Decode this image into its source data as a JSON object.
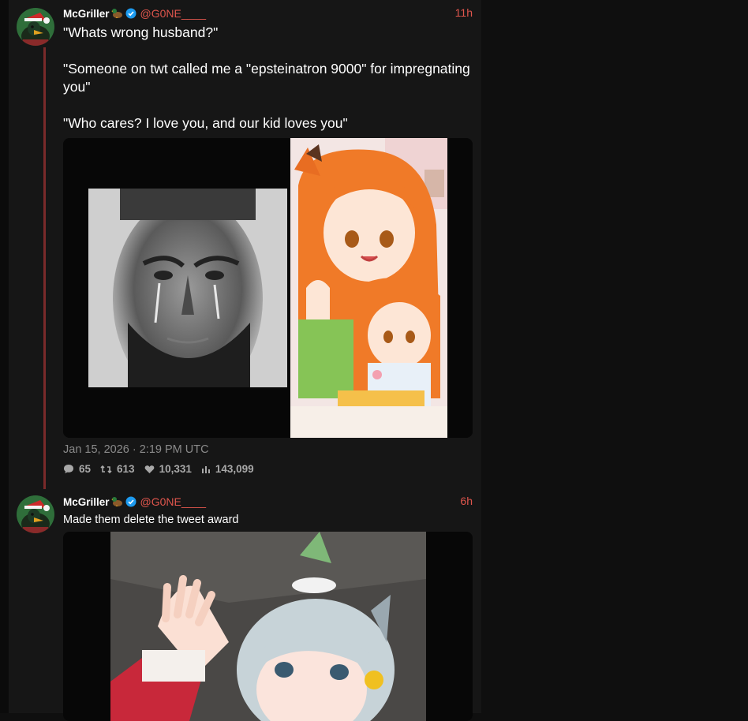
{
  "tweets": [
    {
      "author_name": "McGriller",
      "handle": "@G0NE____",
      "time": "11h",
      "text": "\"Whats wrong husband?\"\n\n\"Someone on twt called me a \"epsteinatron 9000\" for impregnating you\"\n\n\"Who cares? I love you, and our kid loves you\"",
      "date": "Jan 15, 2026 · 2:19 PM UTC",
      "stats": {
        "replies": "65",
        "retweets": "613",
        "likes": "10,331",
        "views": "143,099"
      },
      "media": [
        "crying-man-photo",
        "anime-mother-child-illustration"
      ]
    },
    {
      "author_name": "McGriller",
      "handle": "@G0NE____",
      "time": "6h",
      "text": "Made them delete the tweet award",
      "media": [
        "anime-horse-girl-waving"
      ]
    }
  ],
  "icons": {
    "name_emoji": "duck-icon",
    "verified": "verified-badge-icon",
    "reply": "comment-icon",
    "retweet": "retweet-icon",
    "like": "heart-icon",
    "views": "bar-chart-icon"
  },
  "colors": {
    "accent": "#e0564d",
    "thread_line": "#7a2a2a",
    "verified": "#1d9bf0",
    "muted": "#8a8a8a"
  }
}
